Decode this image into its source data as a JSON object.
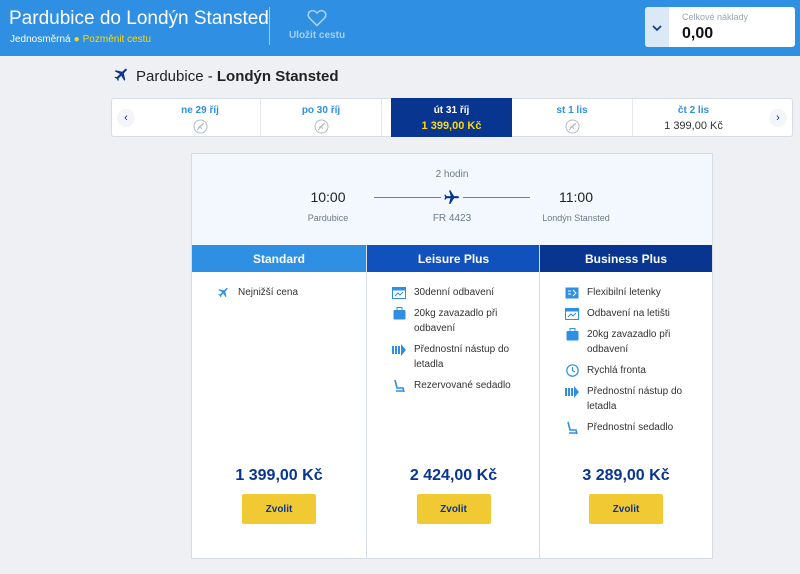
{
  "header": {
    "title": "Pardubice do Londýn Stansted",
    "trip_type": "Jednosměrná",
    "change_link": "Pozměnit cestu",
    "save_label": "Uložit cestu",
    "cost_label": "Celkové náklady",
    "cost_value": "0,00"
  },
  "route": {
    "origin": "Pardubice",
    "separator": " - ",
    "destination": "Londýn Stansted"
  },
  "dates": [
    {
      "label": "ne 29 říj",
      "price": "",
      "available": false,
      "selected": false
    },
    {
      "label": "po 30 říj",
      "price": "",
      "available": false,
      "selected": false
    },
    {
      "label": "út 31 říj",
      "price": "1 399,00 Kč",
      "available": true,
      "selected": true
    },
    {
      "label": "st 1 lis",
      "price": "",
      "available": false,
      "selected": false
    },
    {
      "label": "čt 2 lis",
      "price": "1 399,00 Kč",
      "available": true,
      "selected": false
    }
  ],
  "flight": {
    "duration": "2 hodin",
    "departure_time": "10:00",
    "arrival_time": "11:00",
    "departure_city": "Pardubice",
    "arrival_city": "Londýn Stansted",
    "flight_number": "FR 4423"
  },
  "fares": [
    {
      "name": "Standard",
      "price": "1 399,00 Kč",
      "button": "Zvolit",
      "features": [
        {
          "icon": "plane-icon",
          "text": "Nejnižší cena"
        }
      ]
    },
    {
      "name": "Leisure Plus",
      "price": "2 424,00 Kč",
      "button": "Zvolit",
      "features": [
        {
          "icon": "calendar-icon",
          "text": "30denní odbavení"
        },
        {
          "icon": "suitcase-icon",
          "text": "20kg zavazadlo při odbavení"
        },
        {
          "icon": "priority-boarding-icon",
          "text": "Přednostní nástup do letadla"
        },
        {
          "icon": "seat-icon",
          "text": "Rezervované sedadlo"
        }
      ]
    },
    {
      "name": "Business Plus",
      "price": "3 289,00 Kč",
      "button": "Zvolit",
      "features": [
        {
          "icon": "flexible-ticket-icon",
          "text": "Flexibilní letenky"
        },
        {
          "icon": "airport-checkin-icon",
          "text": "Odbavení na letišti"
        },
        {
          "icon": "suitcase-icon",
          "text": "20kg zavazadlo při odbavení"
        },
        {
          "icon": "fast-track-clock-icon",
          "text": "Rychlá fronta"
        },
        {
          "icon": "priority-boarding-icon",
          "text": "Přednostní nástup do letadla"
        },
        {
          "icon": "seat-icon",
          "text": "Přednostní sedadlo"
        }
      ]
    }
  ],
  "colors": {
    "brand_blue": "#073590",
    "light_blue": "#2e8fe3",
    "mid_blue": "#1051bd",
    "accent_yellow": "#f1c933"
  }
}
